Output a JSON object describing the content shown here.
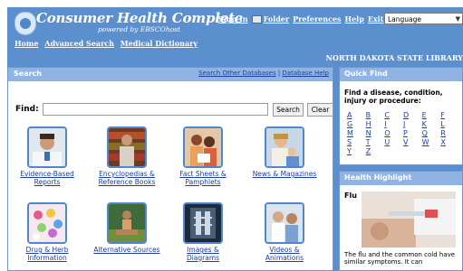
{
  "header": {
    "title": "Consumer Health Complete",
    "powered_by": "powered by EBSCOhost",
    "top_links": [
      "Sign In",
      "Folder",
      "Preferences",
      "Help",
      "Exit"
    ],
    "language_select": "Language",
    "nav_links": [
      "Home",
      "Advanced Search",
      "Medical Dictionary"
    ],
    "library_name": "NORTH DAKOTA STATE LIBRARY"
  },
  "search_panel": {
    "title": "Search",
    "links": [
      "Search Other Databases",
      "Database Help"
    ],
    "find_label": "Find:",
    "find_value": "",
    "search_button": "Search",
    "clear_button": "Clear",
    "tiles": [
      {
        "label_1": "Evidence-Based",
        "label_2": "Reports",
        "icon": "doctor-photo"
      },
      {
        "label_1": "Encyclopedias &",
        "label_2": "Reference Books",
        "icon": "man-bookshelf-photo"
      },
      {
        "label_1": "Fact Sheets &",
        "label_2": "Pamphlets",
        "icon": "women-papers-photo"
      },
      {
        "label_1": "News & Magazines",
        "label_2": "",
        "icon": "woman-child-photo"
      },
      {
        "label_1": "Drug & Herb",
        "label_2": "Information",
        "icon": "pills-photo"
      },
      {
        "label_1": "Alternative Sources",
        "label_2": "",
        "icon": "meditation-photo"
      },
      {
        "label_1": "Images & Diagrams",
        "label_2": "",
        "icon": "xray-photo"
      },
      {
        "label_1": "Videos &",
        "label_2": "Animations",
        "icon": "doctor-patient-photo"
      }
    ]
  },
  "quick_find": {
    "title": "Quick Find",
    "prompt": "Find a disease, condition, injury or procedure:",
    "letters": [
      "A",
      "B",
      "C",
      "D",
      "E",
      "F",
      "G",
      "H",
      "I",
      "J",
      "K",
      "L",
      "M",
      "N",
      "O",
      "P",
      "Q",
      "R",
      "S",
      "T",
      "U",
      "V",
      "W",
      "X",
      "Y",
      "Z"
    ]
  },
  "health_highlight": {
    "title": "Health Highlight",
    "article_title": "Flu",
    "text": "The flu and the common cold have similar symptoms. It can"
  },
  "colors": {
    "background": "#5b8fce",
    "panel_header": "#8fb4e3",
    "link": "#1a3f9c"
  }
}
